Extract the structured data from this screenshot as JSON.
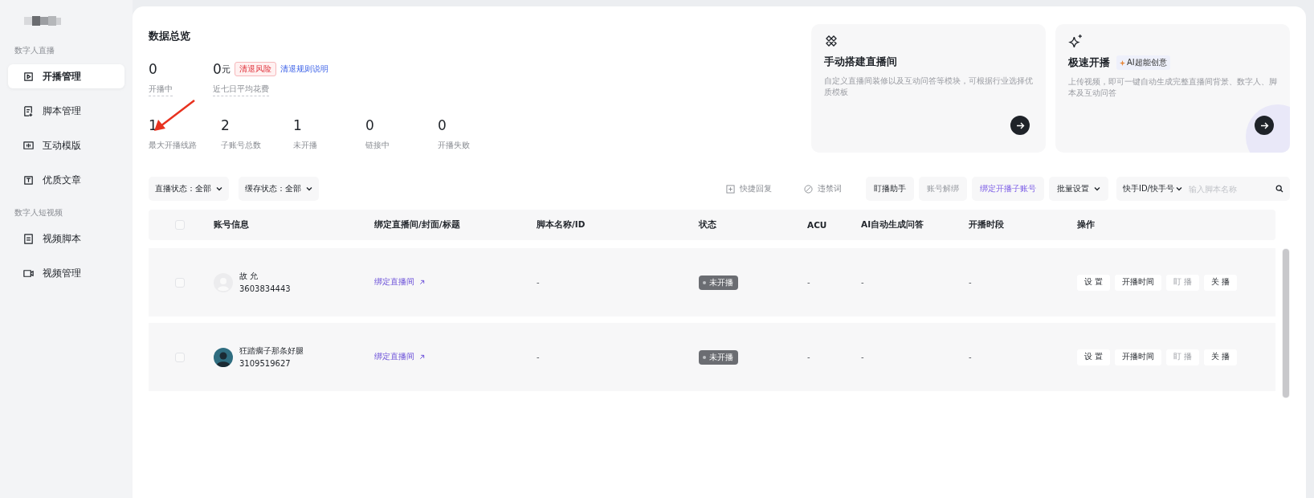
{
  "sidebar": {
    "sections": [
      {
        "title": "数字人直播",
        "items": [
          {
            "label": "开播管理",
            "selected": true
          },
          {
            "label": "脚本管理",
            "selected": false
          },
          {
            "label": "互动模版",
            "selected": false
          },
          {
            "label": "优质文章",
            "selected": false
          }
        ]
      },
      {
        "title": "数字人短视频",
        "items": [
          {
            "label": "视频脚本",
            "selected": false
          },
          {
            "label": "视频管理",
            "selected": false
          }
        ]
      }
    ]
  },
  "overview": {
    "title": "数据总览",
    "top_stats": [
      {
        "value": "0",
        "label": "开播中"
      },
      {
        "value": "0",
        "unit": "元",
        "tag": "清退风险",
        "link": "清退规则说明",
        "label": "近七日平均花费"
      }
    ],
    "stats": [
      {
        "value": "1",
        "label": "最大开播线路"
      },
      {
        "value": "2",
        "label": "子账号总数"
      },
      {
        "value": "1",
        "label": "未开播"
      },
      {
        "value": "0",
        "label": "链接中"
      },
      {
        "value": "0",
        "label": "开播失败"
      }
    ]
  },
  "cards": [
    {
      "title": "手动搭建直播间",
      "description": "自定义直播间装修以及互动问答等模块，可根据行业选择优质模板"
    },
    {
      "title": "极速开播",
      "badge": "AI超能创意",
      "description": "上传视频，即可一键自动生成完整直播间背景、数字人、脚本及互动问答"
    }
  ],
  "filters": [
    {
      "label": "直播状态：全部"
    },
    {
      "label": "缓存状态：全部"
    }
  ],
  "toolbar": [
    {
      "label": "快捷回复",
      "kind": "icon",
      "disabled": false
    },
    {
      "label": "违禁词",
      "kind": "icon",
      "disabled": false
    },
    {
      "label": "盯播助手",
      "kind": "button",
      "disabled": false
    },
    {
      "label": "账号解绑",
      "kind": "button",
      "disabled": true
    },
    {
      "label": "绑定开播子账号",
      "kind": "accent",
      "disabled": false
    },
    {
      "label": "批量设置",
      "kind": "dropdown",
      "disabled": false
    }
  ],
  "search": {
    "type_label": "快手ID/快手号",
    "placeholder": "输入脚本名称"
  },
  "table": {
    "all_checked": false,
    "columns": [
      "账号信息",
      "绑定直播间/封面/标题",
      "脚本名称/ID",
      "状态",
      "ACU",
      "AI自动生成问答",
      "开播时段",
      "操作"
    ],
    "rows": [
      {
        "checked": false,
        "has_photo": false,
        "name": "故 允",
        "account_id": "3603834443",
        "binding": "绑定直播间",
        "script": "-",
        "status": "未开播",
        "acu": "-",
        "ai_answers": "-",
        "schedule": "-",
        "actions": [
          {
            "label": "设 置",
            "disabled": false
          },
          {
            "label": "开播时间",
            "disabled": false
          },
          {
            "label": "盯 播",
            "disabled": true
          },
          {
            "label": "关 播",
            "disabled": false
          }
        ]
      },
      {
        "checked": false,
        "has_photo": true,
        "name": "狂踏瘸子那条好腿",
        "account_id": "3109519627",
        "binding": "绑定直播间",
        "script": "-",
        "status": "未开播",
        "acu": "-",
        "ai_answers": "-",
        "schedule": "-",
        "actions": [
          {
            "label": "设 置",
            "disabled": false
          },
          {
            "label": "开播时间",
            "disabled": false
          },
          {
            "label": "盯 播",
            "disabled": true
          },
          {
            "label": "关 播",
            "disabled": false
          }
        ]
      }
    ]
  }
}
